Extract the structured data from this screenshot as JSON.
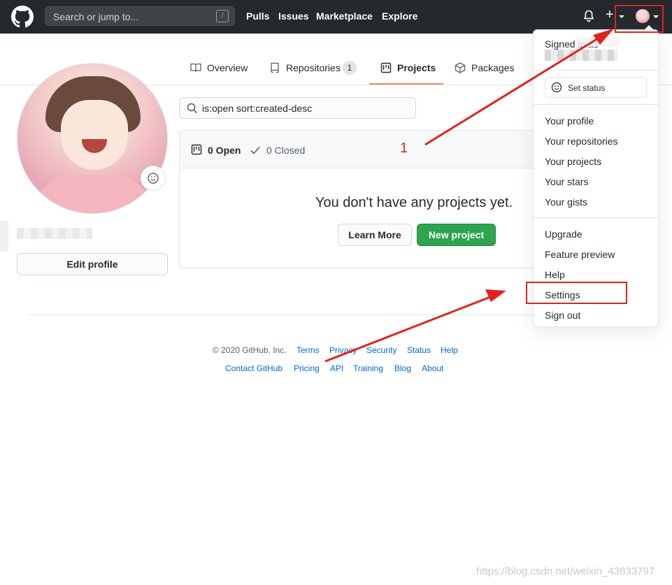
{
  "header": {
    "search_placeholder": "Search or jump to...",
    "search_hint": "/",
    "nav": [
      "Pulls",
      "Issues",
      "Marketplace",
      "Explore"
    ]
  },
  "tabs": [
    {
      "label": "Overview",
      "icon": "book-icon"
    },
    {
      "label": "Repositories",
      "icon": "repo-icon",
      "count": "1"
    },
    {
      "label": "Projects",
      "icon": "project-icon",
      "active": true
    },
    {
      "label": "Packages",
      "icon": "package-icon"
    }
  ],
  "profile": {
    "edit_label": "Edit profile"
  },
  "projects": {
    "filter_value": "is:open sort:created-desc",
    "open_label": "0 Open",
    "closed_label": "0 Closed",
    "blankslate": "You don't have any projects yet.",
    "learn_more": "Learn More",
    "new_project": "New project"
  },
  "dropdown": {
    "signed_in": "Signed in as",
    "set_status": "Set status",
    "group1": [
      "Your profile",
      "Your repositories",
      "Your projects",
      "Your stars",
      "Your gists"
    ],
    "group2": [
      "Upgrade",
      "Feature preview",
      "Help",
      "Settings",
      "Sign out"
    ]
  },
  "footer": {
    "copyright": "© 2020 GitHub, Inc.",
    "row1": [
      "Terms",
      "Privacy",
      "Security",
      "Status",
      "Help"
    ],
    "row2": [
      "Contact GitHub",
      "Pricing",
      "API",
      "Training",
      "Blog",
      "About"
    ]
  },
  "annotation": {
    "number": "1",
    "color": "#e0231a"
  },
  "watermark": "https://blog.csdn.net/weixin_43633797",
  "colors": {
    "header_bg": "#24292e",
    "primary_green": "#2ea44f",
    "link_blue": "#0366d6",
    "active_tab_underline": "#f9826c"
  }
}
